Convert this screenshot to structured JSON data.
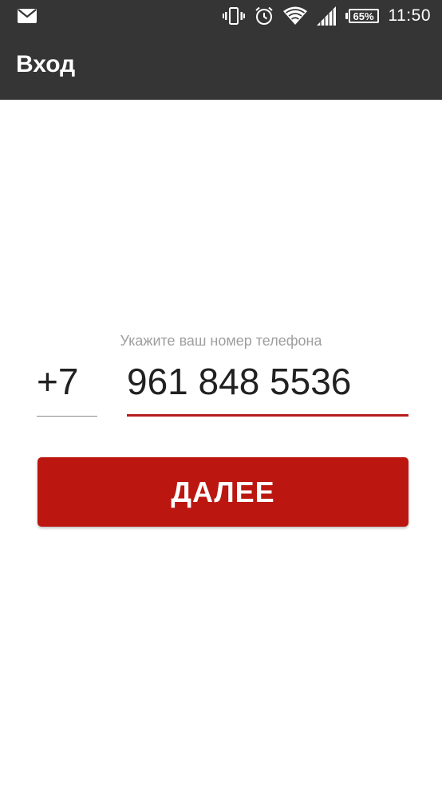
{
  "status_bar": {
    "icons": [
      "mail-icon",
      "vibrate-icon",
      "alarm-icon",
      "wifi-icon",
      "signal-icon"
    ],
    "battery_percent": "65%",
    "time": "11:50"
  },
  "app_bar": {
    "title": "Вход"
  },
  "form": {
    "hint": "Укажите ваш номер телефона",
    "country_code": "+7",
    "phone_value": "961 848 5536",
    "next_label": "ДАЛЕЕ"
  },
  "colors": {
    "bar_background": "#353535",
    "accent": "#bb1710",
    "hint_text": "#9e9e9e"
  }
}
